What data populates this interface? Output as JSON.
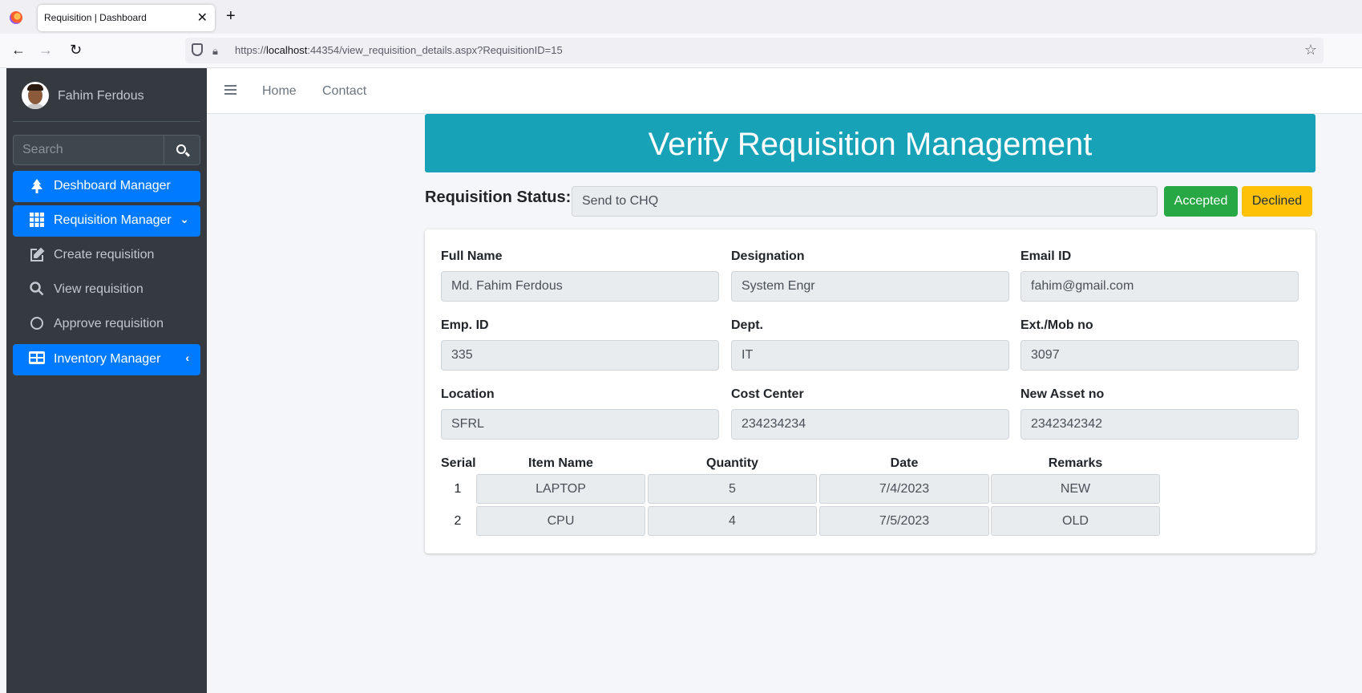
{
  "browser": {
    "tab_title": "Requisition | Dashboard",
    "url_prefix": "https://",
    "url_host": "localhost",
    "url_rest": ":44354/view_requisition_details.aspx?RequisitionID=15"
  },
  "sidebar": {
    "user_name": "Fahim Ferdous",
    "search_placeholder": "Search",
    "items": [
      {
        "label": "Deshboard Manager",
        "icon": "tree-icon",
        "active": true
      },
      {
        "label": "Requisition Manager",
        "icon": "grid-icon",
        "active": true,
        "expanded": true
      },
      {
        "label": "Create requisition",
        "icon": "edit-icon",
        "active": false
      },
      {
        "label": "View requisition",
        "icon": "search-icon",
        "active": false
      },
      {
        "label": "Approve requisition",
        "icon": "circle-icon",
        "active": false
      },
      {
        "label": "Inventory Manager",
        "icon": "table-icon",
        "active": true,
        "expanded": false
      }
    ]
  },
  "topnav": {
    "home": "Home",
    "contact": "Contact"
  },
  "page": {
    "title": "Verify Requisition Management",
    "status_label": "Requisition Status:-",
    "status_value": "Send to CHQ",
    "accept_label": "Accepted",
    "decline_label": "Declined"
  },
  "form": {
    "full_name": {
      "label": "Full Name",
      "value": "Md. Fahim Ferdous"
    },
    "designation": {
      "label": "Designation",
      "value": "System Engr"
    },
    "email": {
      "label": "Email ID",
      "value": "fahim@gmail.com"
    },
    "emp_id": {
      "label": "Emp. ID",
      "value": "335"
    },
    "dept": {
      "label": "Dept.",
      "value": "IT"
    },
    "ext_mob": {
      "label": "Ext./Mob no",
      "value": "3097"
    },
    "location": {
      "label": "Location",
      "value": "SFRL"
    },
    "cost_center": {
      "label": "Cost Center",
      "value": "234234234"
    },
    "new_asset": {
      "label": "New Asset no",
      "value": "2342342342"
    }
  },
  "items_table": {
    "headers": [
      "Serial",
      "Item Name",
      "Quantity",
      "Date",
      "Remarks"
    ],
    "rows": [
      {
        "serial": "1",
        "item": "LAPTOP",
        "quantity": "5",
        "date": "7/4/2023",
        "remarks": "NEW"
      },
      {
        "serial": "2",
        "item": "CPU",
        "quantity": "4",
        "date": "7/5/2023",
        "remarks": "OLD"
      }
    ]
  },
  "colors": {
    "sidebar_bg": "#343a40",
    "primary": "#007bff",
    "banner": "#17a2b8",
    "success": "#28a745",
    "warning": "#ffc107"
  }
}
